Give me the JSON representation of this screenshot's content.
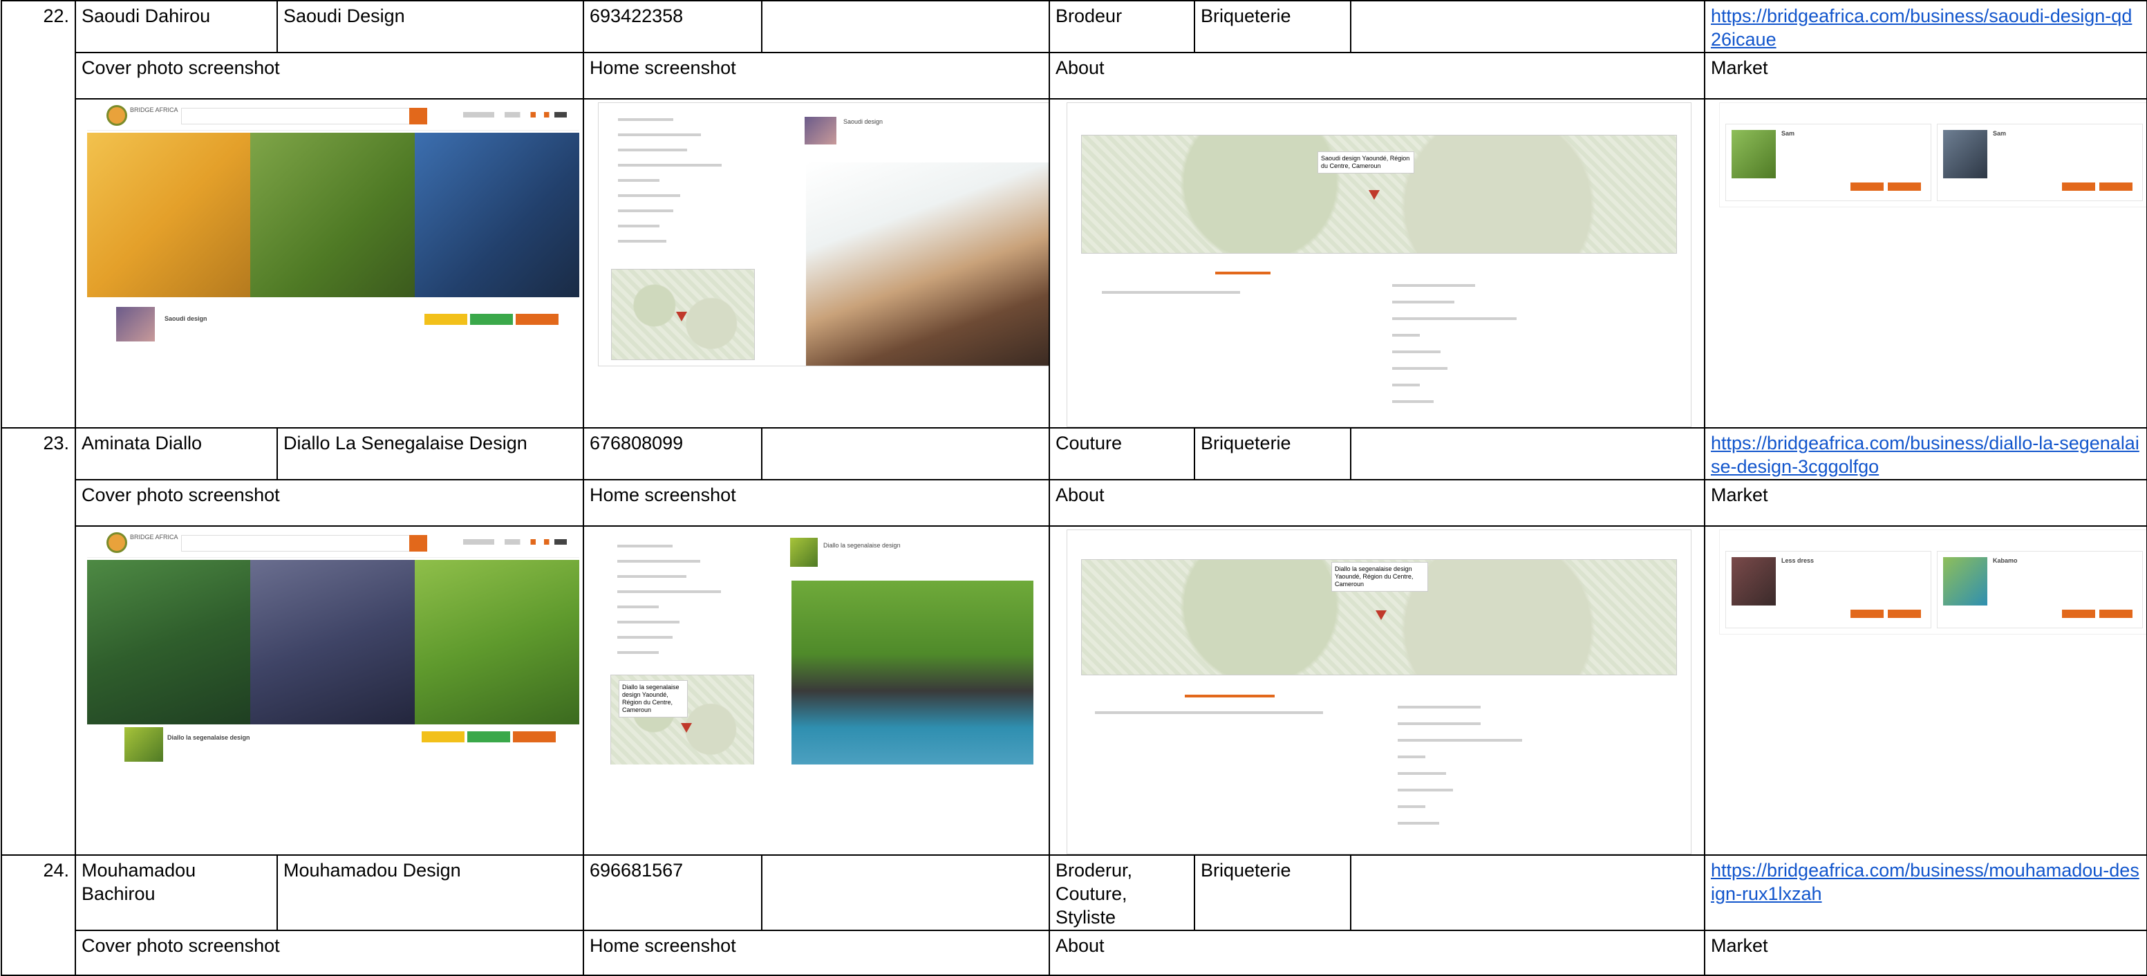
{
  "rows": [
    {
      "num": "22.",
      "name": "Saoudi Dahirou",
      "business": "Saoudi Design",
      "phone": "693422358",
      "category": "Brodeur",
      "location": "Briqueterie",
      "url": "https://bridgeafrica.com/business/saoudi-design-qd26icaue",
      "captions": {
        "cover": "Cover photo screenshot",
        "home": "Home screenshot",
        "about": "About",
        "market": "Market"
      },
      "shot_text": {
        "logo": "BRIDGE AFRICA",
        "profile_name": "Saoudi design",
        "popup": "Saoudi design Yaoundé, Région du Centre, Cameroun",
        "product1": "Sam",
        "product2": "Sam"
      },
      "colors": {
        "cover": [
          "#e8b13a",
          "#5f8c2e",
          "#2f5f9c"
        ],
        "product1": "#7aa84f",
        "product2": "#3b4a5c"
      }
    },
    {
      "num": "23.",
      "name": "Aminata Diallo",
      "business": "Diallo La Senegalaise Design",
      "phone": "676808099",
      "category": "Couture",
      "location": "Briqueterie",
      "url": "https://bridgeafrica.com/business/diallo-la-segenalaise-design-3cggolfgo",
      "captions": {
        "cover": "Cover photo screenshot",
        "home": "Home screenshot",
        "about": "About",
        "market": "Market"
      },
      "shot_text": {
        "logo": "BRIDGE AFRICA",
        "profile_name": "Diallo la segenalaise design",
        "popup": "Diallo la segenalaise design Yaoundé, Région du Centre, Cameroun",
        "product1": "Less dress",
        "product2": "Kabamo"
      },
      "colors": {
        "cover": [
          "#3d6b3a",
          "#4a4f73",
          "#6f9a35"
        ],
        "product1": "#5a3a3a",
        "product2": "#5d8a3a"
      }
    },
    {
      "num": "24.",
      "name": "Mouhamadou Bachirou",
      "business": "Mouhamadou Design",
      "phone": "696681567",
      "category": "Broderur, Couture, Styliste",
      "location": "Briqueterie",
      "url": "https://bridgeafrica.com/business/mouhamadou-design-rux1lxzah",
      "captions": {
        "cover": "Cover photo screenshot",
        "home": "Home screenshot",
        "about": "About",
        "market": "Market"
      }
    }
  ]
}
